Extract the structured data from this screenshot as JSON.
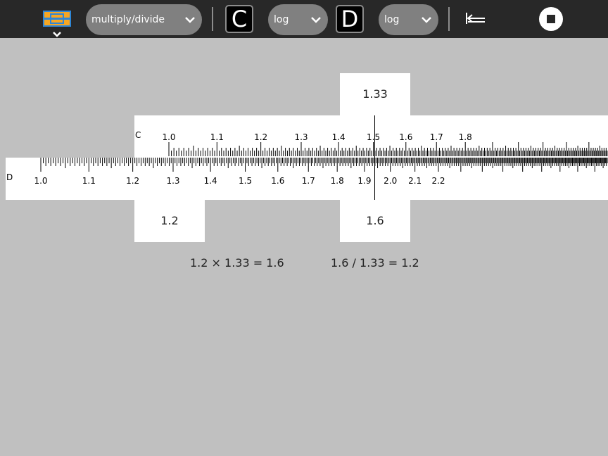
{
  "toolbar": {
    "activity_icon": "slide-rule-activity-icon",
    "function_select": "multiply/divide",
    "slide_label": "C",
    "slide_scale_select": "log",
    "stator_label": "D",
    "stator_scale_select": "log",
    "return_icon": "return-to-left-icon",
    "stop_icon": "stop-icon"
  },
  "readouts": {
    "cursor_c": "1.33",
    "slide_start": "1.2",
    "cursor_d": "1.6"
  },
  "equations": {
    "multiply": "1.2 × 1.33 = 1.6",
    "divide": "1.6 / 1.33 = 1.2"
  },
  "slide": {
    "label": "C",
    "major_labels": [
      "1.0",
      "1.1",
      "1.2",
      "1.3",
      "1.4",
      "1.5",
      "1.6",
      "1.7",
      "1.8"
    ]
  },
  "stator": {
    "label": "D",
    "major_labels": [
      "1.0",
      "1.1",
      "1.2",
      "1.3",
      "1.4",
      "1.5",
      "1.6",
      "1.7",
      "1.8",
      "1.9",
      "2.0",
      "2.1",
      "2.2"
    ]
  },
  "colors": {
    "toolbar": "#282828",
    "background": "#c0c0c0",
    "rule": "#ffffff",
    "combo": "#808080",
    "icon_orange": "#f5a623",
    "icon_blue": "#2e86d6"
  }
}
